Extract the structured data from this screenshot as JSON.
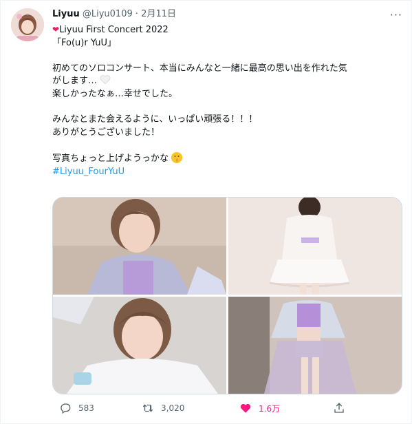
{
  "tweet": {
    "author_name": "Liyuu",
    "author_handle": "@Liyu0109",
    "separator": "·",
    "date": "2月11日",
    "lines": [
      "Liyuu First Concert 2022",
      "「Fo(u)r YuU」",
      "",
      "初めてのソロコンサート、本当にみんなと一緒に最高の思い出を作れた気",
      "がします…",
      "楽しかったなぁ…幸せでした。",
      "",
      "みんなとまた会えるように、いっぱい頑張る！！！",
      "ありがとうございました！",
      "",
      "写真ちょっと上げようっかな"
    ],
    "hashtag": "#Liyuu_FourYuU"
  },
  "media": {
    "photos": [
      {
        "name": "photo-top-left"
      },
      {
        "name": "photo-top-right"
      },
      {
        "name": "photo-bottom-left"
      },
      {
        "name": "photo-bottom-right"
      }
    ]
  },
  "actions": {
    "replies": "583",
    "retweets": "3,020",
    "likes": "1.6万"
  },
  "colors": {
    "link": "#1d9bf0",
    "like": "#f91880",
    "muted": "#536471"
  },
  "icons": [
    "more-icon",
    "red-heart-icon",
    "white-heart-icon",
    "shushing-face-icon",
    "reply-icon",
    "retweet-icon",
    "like-icon",
    "share-icon"
  ]
}
